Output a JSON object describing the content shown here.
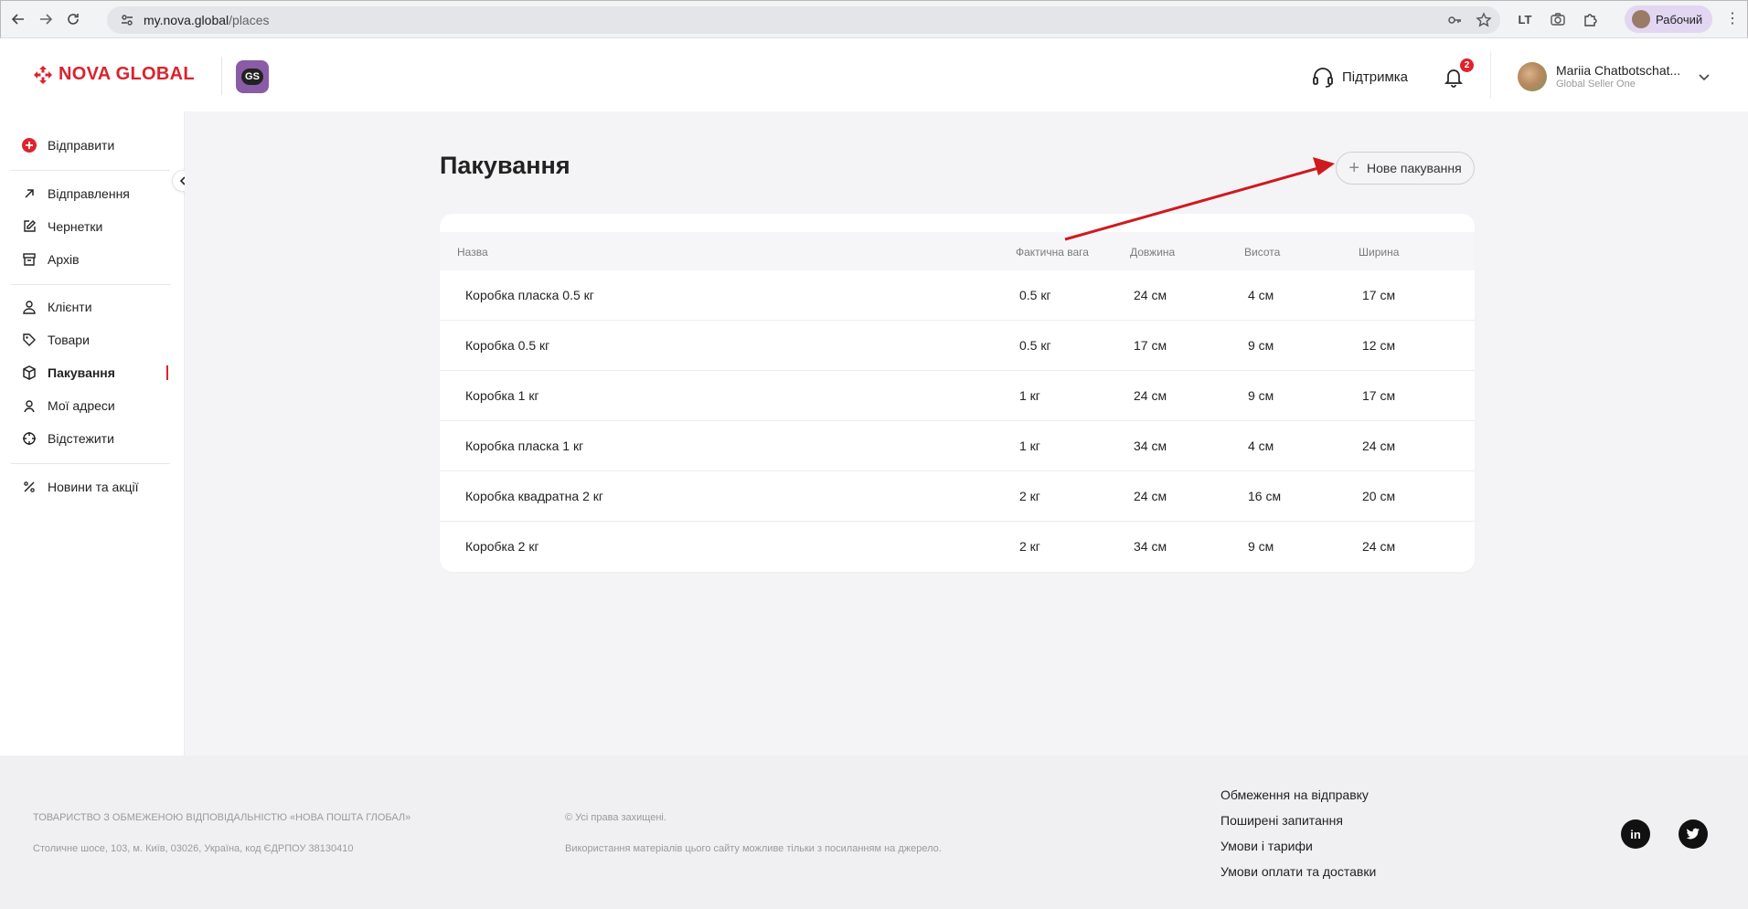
{
  "browser": {
    "url_host": "my.nova.global",
    "url_path": "/places",
    "profile_label": "Рабочий",
    "extension_label": "LT"
  },
  "header": {
    "brand": "NOVA GLOBAL",
    "badge": "GS",
    "support_label": "Підтримка",
    "notifications_count": "2",
    "user_name": "Mariia Chatbotschat...",
    "user_role": "Global Seller One"
  },
  "sidebar": {
    "send_label": "Відправити",
    "items": [
      {
        "label": "Відправлення"
      },
      {
        "label": "Чернетки"
      },
      {
        "label": "Архів"
      },
      {
        "label": "Клієнти"
      },
      {
        "label": "Товари"
      },
      {
        "label": "Пакування"
      },
      {
        "label": "Мої адреси"
      },
      {
        "label": "Відстежити"
      },
      {
        "label": "Новини та акції"
      }
    ]
  },
  "main": {
    "title": "Пакування",
    "new_button_label": "Нове пакування",
    "columns": [
      "Назва",
      "Фактична вага",
      "Довжина",
      "Висота",
      "Ширина"
    ],
    "rows": [
      [
        "Коробка пласка 0.5 кг",
        "0.5 кг",
        "24 см",
        "4 см",
        "17 см"
      ],
      [
        "Коробка 0.5 кг",
        "0.5 кг",
        "17 см",
        "9 см",
        "12 см"
      ],
      [
        "Коробка 1 кг",
        "1 кг",
        "24 см",
        "9 см",
        "17 см"
      ],
      [
        "Коробка пласка 1 кг",
        "1 кг",
        "34 см",
        "4 см",
        "24 см"
      ],
      [
        "Коробка квадратна 2 кг",
        "2 кг",
        "24 см",
        "16 см",
        "20 см"
      ],
      [
        "Коробка 2 кг",
        "2 кг",
        "34 см",
        "9 см",
        "24 см"
      ]
    ]
  },
  "footer": {
    "company": "ТОВАРИСТВО З ОБМЕЖЕНОЮ ВІДПОВІДАЛЬНІСТЮ «НОВА ПОШТА ГЛОБАЛ»",
    "address": "Столичне шосе, 103, м. Київ, 03026, Україна, код ЄДРПОУ 38130410",
    "rights": "© Усі права захищені.",
    "usage": "Використання матеріалів цього сайту можливе тільки з посиланням на джерело.",
    "links": [
      "Обмеження на відправку",
      "Поширені запитання",
      "Умови і тарифи",
      "Умови оплати та доставки"
    ],
    "social": [
      "in",
      "twitter"
    ]
  },
  "colors": {
    "brand_red": "#d9232e",
    "badge_purple": "#8a5ca6",
    "annotation_arrow": "#d0191f"
  }
}
